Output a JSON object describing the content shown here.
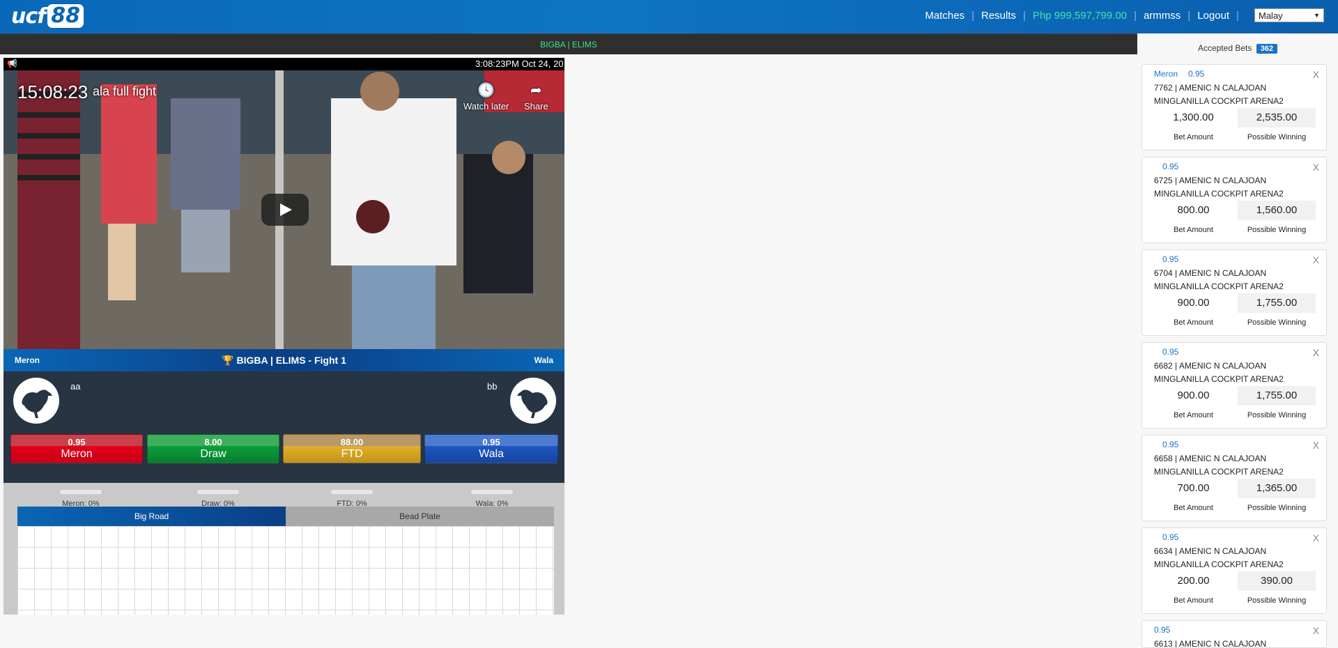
{
  "header": {
    "logo_text": "ucf",
    "logo_number": "88",
    "nav": [
      "Matches",
      "Results"
    ],
    "balance": "Php 999,597,799.00",
    "username": "armmss",
    "logout": "Logout",
    "language": "Malay"
  },
  "event_bar": "BIGBA | ELIMS",
  "stream": {
    "clock": "3:08:23PM Oct 24, 20",
    "video_time": "15:08:23",
    "video_title": "ala full fight",
    "watch_later": "Watch later",
    "share": "Share"
  },
  "fight": {
    "left_side": "Meron",
    "title": "BIGBA | ELIMS - Fight 1",
    "right_side": "Wala",
    "left_fighter": "aa",
    "right_fighter": "bb"
  },
  "bet_buttons": [
    {
      "odds": "0.95",
      "label": "Meron"
    },
    {
      "odds": "8.00",
      "label": "Draw"
    },
    {
      "odds": "88.00",
      "label": "FTD"
    },
    {
      "odds": "0.95",
      "label": "Wala"
    }
  ],
  "stats": [
    "Meron: 0%",
    "Draw: 0%",
    "FTD: 0%",
    "Wala: 0%"
  ],
  "tabs": {
    "big_road": "Big Road",
    "bead_plate": "Bead Plate"
  },
  "accepted": {
    "title": "Accepted Bets",
    "count": "362",
    "amount_label": "Bet Amount",
    "winning_label": "Possible Winning",
    "close": "X",
    "bets": [
      {
        "side": "Meron",
        "odds": "0.95",
        "desc": "7762 | AMENIC N CALAJOAN MINGLANILLA COCKPIT ARENA2",
        "amount": "1,300.00",
        "winning": "2,535.00"
      },
      {
        "side": "",
        "odds": "0.95",
        "desc": "6725 | AMENIC N CALAJOAN MINGLANILLA COCKPIT ARENA2",
        "amount": "800.00",
        "winning": "1,560.00"
      },
      {
        "side": "",
        "odds": "0.95",
        "desc": "6704 | AMENIC N CALAJOAN MINGLANILLA COCKPIT ARENA2",
        "amount": "900.00",
        "winning": "1,755.00"
      },
      {
        "side": "",
        "odds": "0.95",
        "desc": "6682 | AMENIC N CALAJOAN MINGLANILLA COCKPIT ARENA2",
        "amount": "900.00",
        "winning": "1,755.00"
      },
      {
        "side": "",
        "odds": "0.95",
        "desc": "6658 | AMENIC N CALAJOAN MINGLANILLA COCKPIT ARENA2",
        "amount": "700.00",
        "winning": "1,365.00"
      },
      {
        "side": "",
        "odds": "0.95",
        "desc": "6634 | AMENIC N CALAJOAN MINGLANILLA COCKPIT ARENA2",
        "amount": "200.00",
        "winning": "390.00"
      },
      {
        "side": "",
        "odds": "0.95",
        "desc": "6613 | AMENIC N CALAJOAN",
        "amount": "",
        "winning": ""
      }
    ]
  }
}
